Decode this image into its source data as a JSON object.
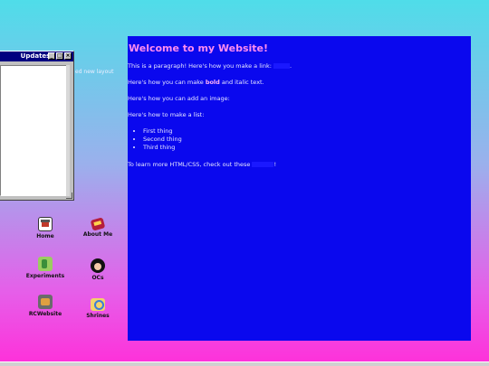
{
  "updates_window": {
    "title": "Updates",
    "stray_text": "ed new layout"
  },
  "desktop_icons": [
    {
      "label": "Home"
    },
    {
      "label": "About Me"
    },
    {
      "label": "Experiments"
    },
    {
      "label": "OCs"
    },
    {
      "label": "RCWebsite"
    },
    {
      "label": "Shrines"
    }
  ],
  "content": {
    "heading": "Welcome to my Website!",
    "p1": "This is a paragraph! Here's how you make a link:",
    "p1_end": ".",
    "p2_pre": "Here's how you can make ",
    "p2_bold": "bold",
    "p2_post": " and italic text.",
    "p3": "Here's how you can add an image:",
    "p4": "Here's how to make a list:",
    "list": [
      "First thing",
      "Second thing",
      "Third thing"
    ],
    "p5": "To learn more HTML/CSS, check out these",
    "p5_end": "!"
  }
}
